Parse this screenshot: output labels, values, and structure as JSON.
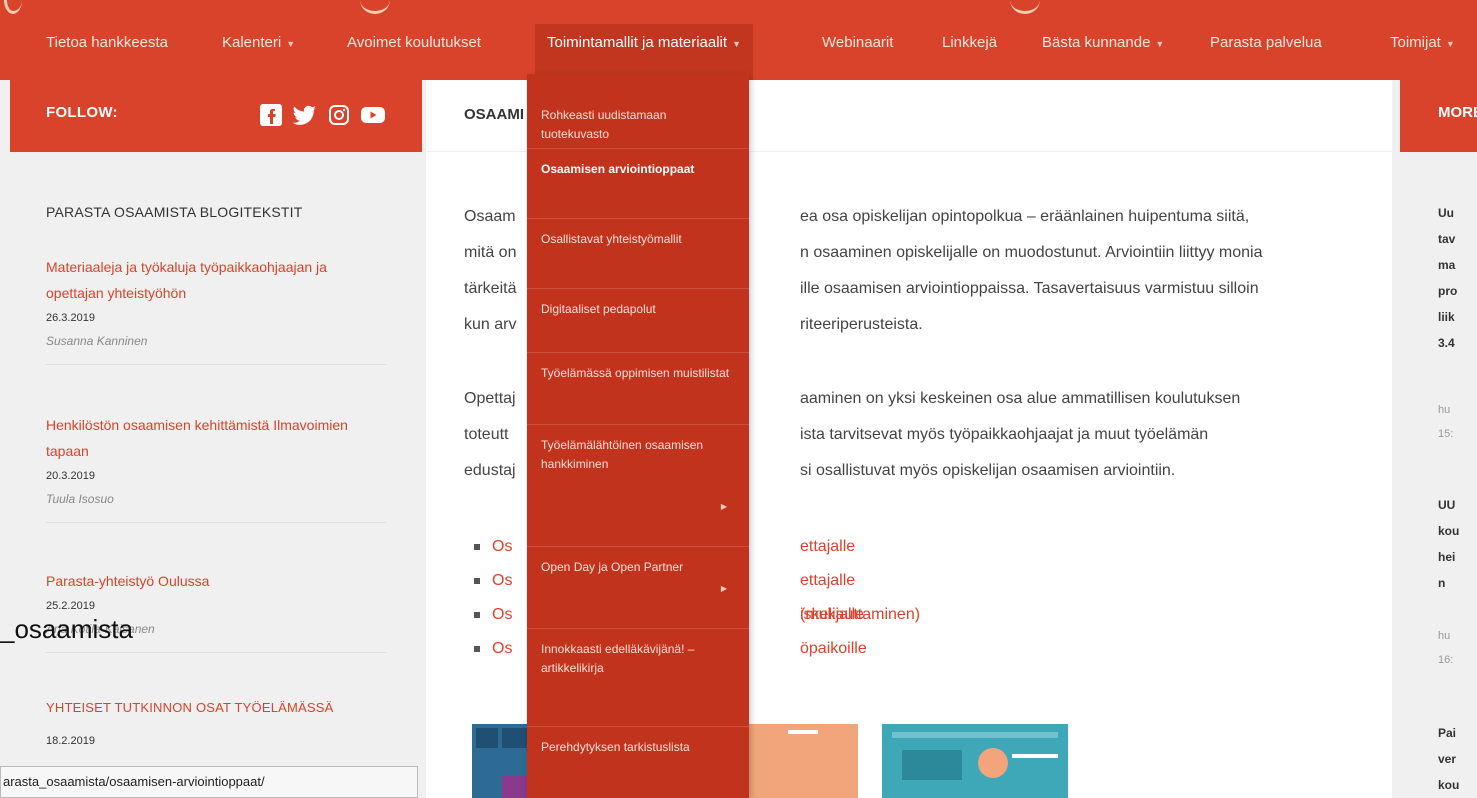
{
  "nav": {
    "items": [
      {
        "label": "Tietoa hankkeesta",
        "caret": false
      },
      {
        "label": "Kalenteri",
        "caret": true
      },
      {
        "label": "Avoimet koulutukset",
        "caret": false
      },
      {
        "label": "Toimintamallit ja materiaalit",
        "caret": true,
        "active": true
      },
      {
        "label": "Webinaarit",
        "caret": false
      },
      {
        "label": "Linkkejä",
        "caret": false
      },
      {
        "label": "Bästa kunnande",
        "caret": true
      },
      {
        "label": "Parasta palvelua",
        "caret": false
      },
      {
        "label": "Toimijat",
        "caret": true
      }
    ],
    "caret_glyph": "▼"
  },
  "follow": {
    "label": "FOLLOW:",
    "icons": [
      "facebook-icon",
      "twitter-icon",
      "instagram-icon",
      "youtube-icon"
    ]
  },
  "more_label": "MORE",
  "sidebar": {
    "heading": "PARASTA OSAAMISTA BLOGITEKSTIT",
    "posts": [
      {
        "title": "Materiaaleja ja työkaluja työpaikkaohjaajan ja opettajan yhteistyöhön",
        "date": "26.3.2019",
        "author": "Susanna Kanninen"
      },
      {
        "title": "Henkilöstön osaamisen kehittämistä Ilmavoimien tapaan",
        "date": "20.3.2019",
        "author": "Tuula Isosuo"
      },
      {
        "title": "Parasta-yhteistyö Oulussa",
        "date": "25.2.2019",
        "author": "Arja Kotila-Kaisanen"
      }
    ],
    "section2_heading": "YHTEISET TUTKINNON OSAT TYÖELÄMÄSSÄ",
    "section2_date": "18.2.2019"
  },
  "main": {
    "header": "OSAAMI",
    "para1": [
      "Osaam",
      "ea osa opiskelijan opintopolkua – eräänlainen huipentuma siitä,",
      "mitä on",
      "n osaaminen opiskelijalle on muodostunut. Arviointiin liittyy monia",
      "tärkeitä",
      "ille osaamisen arviointioppaissa. Tasavertaisuus varmistuu silloin",
      "kun arv",
      "riteeriperusteista."
    ],
    "para2": [
      "Opettaj",
      "aaminen on yksi keskeinen osa alue ammatillisen koulutuksen",
      "toteutt",
      "ista tarvitsevat myös työpaikkaohjaajat ja muut työelämän",
      "edustaj",
      "si osallistuvat myös opiskelijan osaamisen arviointiin."
    ],
    "links": [
      {
        "left": "Os",
        "right": "ettajalle"
      },
      {
        "left": "Os",
        "right": "ettajalle (mukauttaminen)"
      },
      {
        "left": "Os",
        "right": "iskelijalle"
      },
      {
        "left": "Os",
        "right": "öpaikoille"
      }
    ]
  },
  "dropdown": {
    "items": [
      {
        "label": "Rohkeasti uudistamaan tuotekuvasto",
        "active": false,
        "sub": false
      },
      {
        "label": "Osaamisen arviointioppaat",
        "active": true,
        "sub": false
      },
      {
        "label": "Osallistavat yhteistyömallit",
        "active": false,
        "sub": false
      },
      {
        "label": "Digitaaliset pedapolut",
        "active": false,
        "sub": false
      },
      {
        "label": "Työelämässä oppimisen muistilistat",
        "active": false,
        "sub": false
      },
      {
        "label": "Työelämälähtöinen osaamisen hankkiminen",
        "active": false,
        "sub": true
      },
      {
        "label": "Open Day ja Open Partner",
        "active": false,
        "sub": true
      },
      {
        "label": "Innokkaasti edelläkävijänä! – artikkelikirja",
        "active": false,
        "sub": false
      },
      {
        "label": "Perehdytyksen tarkistuslista",
        "active": false,
        "sub": false
      }
    ],
    "sub_glyph": "▶"
  },
  "rightcol": {
    "lines1": [
      "Uu",
      "tav",
      "ma",
      "pro",
      "liik",
      "3.4"
    ],
    "meta1": [
      "hu",
      "15:"
    ],
    "lines2": [
      "UU",
      "kou",
      "hei",
      "n"
    ],
    "meta2": [
      "hu",
      "16:"
    ],
    "lines3": [
      "Pai",
      "ver",
      "kou"
    ]
  },
  "status_url": "arasta_osaamista/osaamisen-arviointioppaat/",
  "overlay_text": "_osaamista",
  "colors": {
    "accent": "#d9432b",
    "dropdown": "#c2331e"
  }
}
